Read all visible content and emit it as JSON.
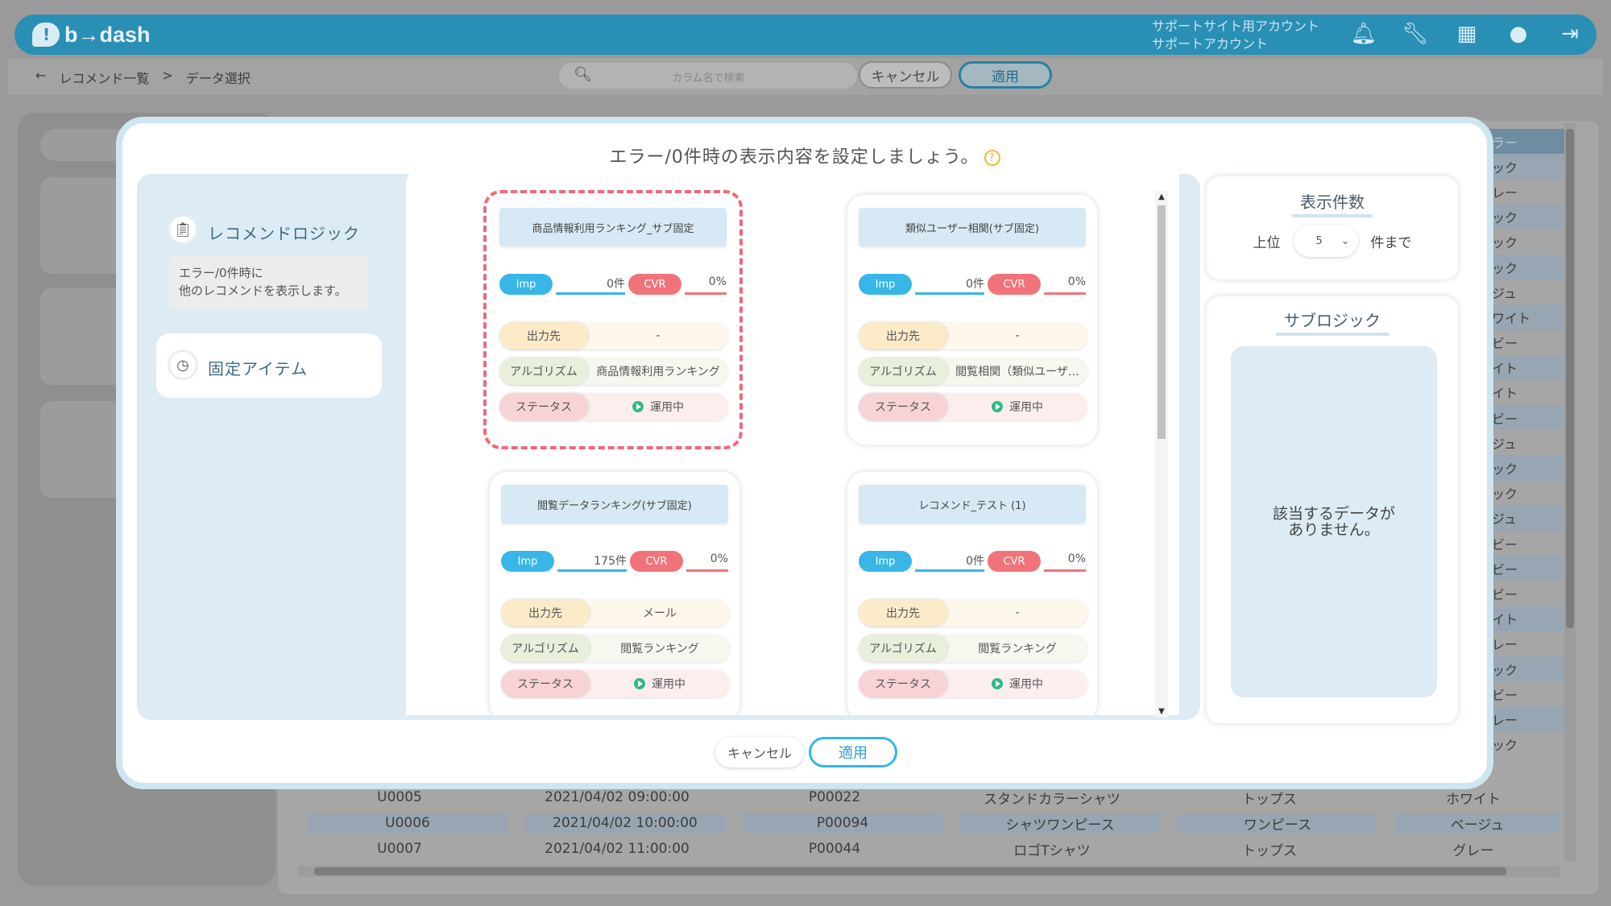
{
  "header": {
    "logo_text": "b→dash",
    "account_line1": "サポートサイト用アカウント",
    "account_line2": "サポートアカウント",
    "icons": [
      "bell-icon",
      "wrench-icon",
      "grid-icon",
      "chat-icon",
      "logout-icon"
    ]
  },
  "subbar": {
    "back_glyph": "←",
    "crumb1": "レコメンド一覧",
    "crumb_sep": ">",
    "crumb2": "データ選択",
    "search_placeholder": "カラム名で検索",
    "cancel_label": "キャンセル",
    "apply_label": "適用"
  },
  "background_table": {
    "rows": [
      [
        "U0005",
        "2021/04/02 09:00:00",
        "P00022",
        "スタンドカラーシャツ",
        "トップス",
        "ホワイト"
      ],
      [
        "U0006",
        "2021/04/02 10:00:00",
        "P00094",
        "シャツワンピース",
        "ワンピース",
        "ベージュ"
      ],
      [
        "U0007",
        "2021/04/02 11:00:00",
        "P00044",
        "ロゴTシャツ",
        "トップス",
        "グレー"
      ]
    ],
    "color_column": [
      "ラー",
      "ック",
      "レー",
      "ック",
      "ック",
      "ック",
      "ジュ",
      "ワイト",
      "ビー",
      "イト",
      "イト",
      "ビー",
      "ジュ",
      "ック",
      "ック",
      "ジュ",
      "ビー",
      "ビー",
      "ビー",
      "イト",
      "レー",
      "ック",
      "ビー",
      "レー",
      "ック"
    ]
  },
  "modal": {
    "title": "エラー/0件時の表示内容を設定しましょう。",
    "help_glyph": "?",
    "tabs": [
      {
        "label": "レコメンドロジック",
        "desc_line1": "エラー/0件時に",
        "desc_line2": "他のレコメンドを表示します。"
      },
      {
        "label": "固定アイテム"
      }
    ],
    "cards": [
      {
        "name": "商品情報利用ランキング_サブ固定",
        "imp_label": "Imp",
        "imp": "0件",
        "cvr_label": "CVR",
        "cvr": "0%",
        "output_label": "出力先",
        "output": "-",
        "algorithm_label": "アルゴリズム",
        "algorithm": "商品情報利用ランキング",
        "status_label": "ステータス",
        "status": "運用中",
        "selected": true
      },
      {
        "name": "類似ユーザー相関(サブ固定)",
        "imp_label": "Imp",
        "imp": "0件",
        "cvr_label": "CVR",
        "cvr": "0%",
        "output_label": "出力先",
        "output": "-",
        "algorithm_label": "アルゴリズム",
        "algorithm": "閲覧相関（類似ユーザ…",
        "status_label": "ステータス",
        "status": "運用中",
        "selected": false
      },
      {
        "name": "閲覧データランキング(サブ固定)",
        "imp_label": "Imp",
        "imp": "175件",
        "cvr_label": "CVR",
        "cvr": "0%",
        "output_label": "出力先",
        "output": "メール",
        "algorithm_label": "アルゴリズム",
        "algorithm": "閲覧ランキング",
        "status_label": "ステータス",
        "status": "運用中",
        "selected": false
      },
      {
        "name": "レコメンド_テスト (1)",
        "imp_label": "Imp",
        "imp": "0件",
        "cvr_label": "CVR",
        "cvr": "0%",
        "output_label": "出力先",
        "output": "-",
        "algorithm_label": "アルゴリズム",
        "algorithm": "閲覧ランキング",
        "status_label": "ステータス",
        "status": "運用中",
        "selected": false
      }
    ],
    "display_count": {
      "title": "表示件数",
      "prefix": "上位",
      "value": "5",
      "suffix": "件まで"
    },
    "sublogic": {
      "title": "サブロジック",
      "empty_line1": "該当するデータが",
      "empty_line2": "ありません。"
    },
    "cancel_label": "キャンセル",
    "apply_label": "適用"
  },
  "colors": {
    "brand": "#2a8fb5",
    "imp": "#38b6e8",
    "cvr": "#f1737a",
    "selected_border": "#ec6b7a",
    "status_ok": "#2fb98a"
  }
}
